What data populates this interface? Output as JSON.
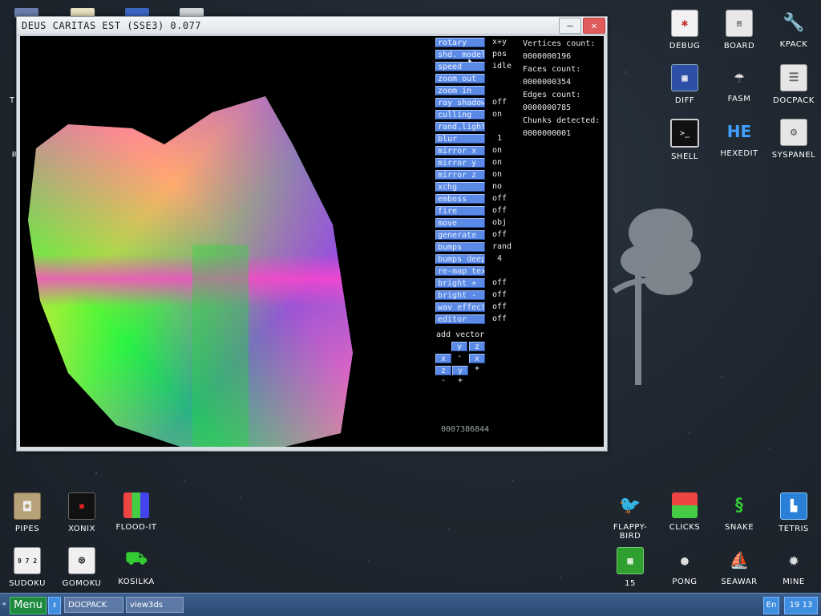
{
  "window": {
    "title": "DEUS CARITAS EST (SSE3) 0.077",
    "minimize_label": "–",
    "close_label": "✕"
  },
  "controls": [
    {
      "label": "rotary",
      "value": "x+y"
    },
    {
      "label": "shd. model",
      "value": "pos"
    },
    {
      "label": "speed",
      "value": "idle"
    },
    {
      "label": "zoom out",
      "value": ""
    },
    {
      "label": "zoom in",
      "value": ""
    },
    {
      "label": "ray shadow",
      "value": "off"
    },
    {
      "label": "culling",
      "value": "on"
    },
    {
      "label": "rand.light",
      "value": ""
    },
    {
      "label": "blur",
      "value": "1"
    },
    {
      "label": "mirror x",
      "value": "on"
    },
    {
      "label": "mirror y",
      "value": "on"
    },
    {
      "label": "mirror z",
      "value": "on"
    },
    {
      "label": "xchg",
      "value": "no"
    },
    {
      "label": "emboss",
      "value": "off"
    },
    {
      "label": "fire",
      "value": "off"
    },
    {
      "label": "move",
      "value": "obj"
    },
    {
      "label": "generate",
      "value": "off"
    },
    {
      "label": "bumps",
      "value": "rand"
    },
    {
      "label": "bumps deep",
      "value": "4"
    },
    {
      "label": "re-map tex",
      "value": ""
    },
    {
      "label": "bright +",
      "value": "off"
    },
    {
      "label": "bright -",
      "value": "off"
    },
    {
      "label": "wav effect",
      "value": "off"
    },
    {
      "label": "editor",
      "value": "off"
    }
  ],
  "vector": {
    "label": "add vector",
    "y_minus": "y -",
    "z_plus": "z +",
    "x_minus": "x -",
    "x_plus": "x +",
    "z_minus": "z -",
    "y_plus": "y +"
  },
  "stats": {
    "vertices_label": "Vertices count:",
    "vertices_value": "0000000196",
    "faces_label": "Faces count:",
    "faces_value": "0000000354",
    "edges_label": "Edges count:",
    "edges_value": "0000000785",
    "chunks_label": "Chunks detected:",
    "chunks_value": "0000000001",
    "bottom_counter": "0007386844"
  },
  "desktop_icons_right": [
    {
      "label": "DEBUG",
      "icon": "debug-icon"
    },
    {
      "label": "BOARD",
      "icon": "board-icon"
    },
    {
      "label": "KPACK",
      "icon": "kpack-icon"
    },
    {
      "label": "DIFF",
      "icon": "diff-icon"
    },
    {
      "label": "FASM",
      "icon": "fasm-icon"
    },
    {
      "label": "DOCPACK",
      "icon": "docpack-icon"
    },
    {
      "label": "SHELL",
      "icon": "shell-icon"
    },
    {
      "label": "HEXEDIT",
      "icon": "hexedit-icon"
    },
    {
      "label": "SYSPANEL",
      "icon": "syspanel-icon"
    }
  ],
  "desktop_icons_bottom_left": [
    {
      "label": "PIPES",
      "icon": "pipes-icon"
    },
    {
      "label": "XONIX",
      "icon": "xonix-icon"
    },
    {
      "label": "FLOOD-IT",
      "icon": "flood-it-icon"
    },
    {
      "label": "SUDOKU",
      "icon": "sudoku-icon"
    },
    {
      "label": "GOMOKU",
      "icon": "gomoku-icon"
    },
    {
      "label": "KOSILKA",
      "icon": "kosilka-icon"
    }
  ],
  "desktop_icons_bottom_right": [
    {
      "label": "FLAPPY-BIRD",
      "icon": "flappy-bird-icon"
    },
    {
      "label": "CLICKS",
      "icon": "clicks-icon"
    },
    {
      "label": "SNAKE",
      "icon": "snake-icon"
    },
    {
      "label": "TETRIS",
      "icon": "tetris-icon"
    },
    {
      "label": "15",
      "icon": "fifteen-icon"
    },
    {
      "label": "PONG",
      "icon": "pong-icon"
    },
    {
      "label": "SEAWAR",
      "icon": "seawar-icon"
    },
    {
      "label": "MINE",
      "icon": "mine-icon"
    }
  ],
  "hexedit_glyph": "HE",
  "sudoku_glyph": "9 7 2",
  "partial_left_labels": [
    "T",
    "R"
  ],
  "taskbar": {
    "menu_label": "Menu",
    "arrow_label": "↕",
    "items": [
      "DOCPACK",
      "view3ds"
    ],
    "lang": "En",
    "clock": "19 13"
  }
}
